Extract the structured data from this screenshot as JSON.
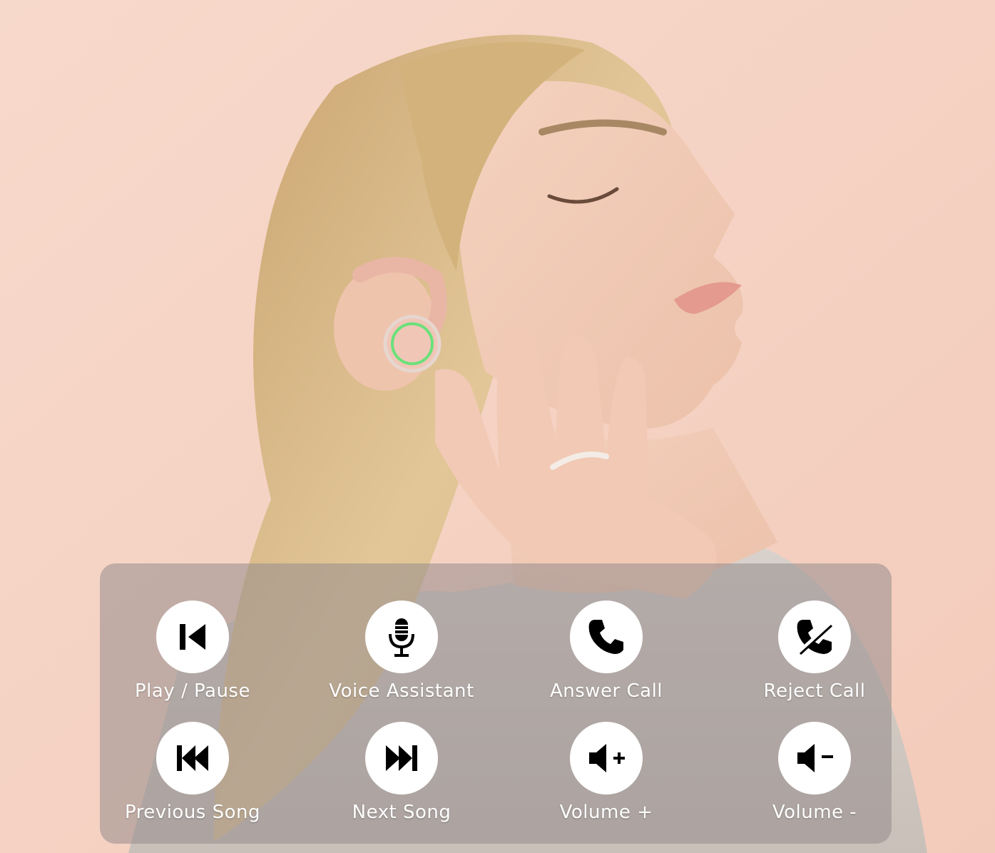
{
  "colors": {
    "background": "#f6d4c6",
    "panel": "rgba(150,140,140,0.55)",
    "icon_circle": "#ffffff",
    "icon_glyph": "#000000",
    "label_text": "#ffffff",
    "earbud_led": "#6be07a"
  },
  "controls": [
    {
      "label": "Play / Pause",
      "icon": "play-pause-icon"
    },
    {
      "label": "Voice Assistant",
      "icon": "microphone-icon"
    },
    {
      "label": "Answer Call",
      "icon": "phone-icon"
    },
    {
      "label": "Reject Call",
      "icon": "phone-off-icon"
    },
    {
      "label": "Previous Song",
      "icon": "previous-track-icon"
    },
    {
      "label": "Next Song",
      "icon": "next-track-icon"
    },
    {
      "label": "Volume +",
      "icon": "volume-up-icon"
    },
    {
      "label": "Volume -",
      "icon": "volume-down-icon"
    }
  ]
}
